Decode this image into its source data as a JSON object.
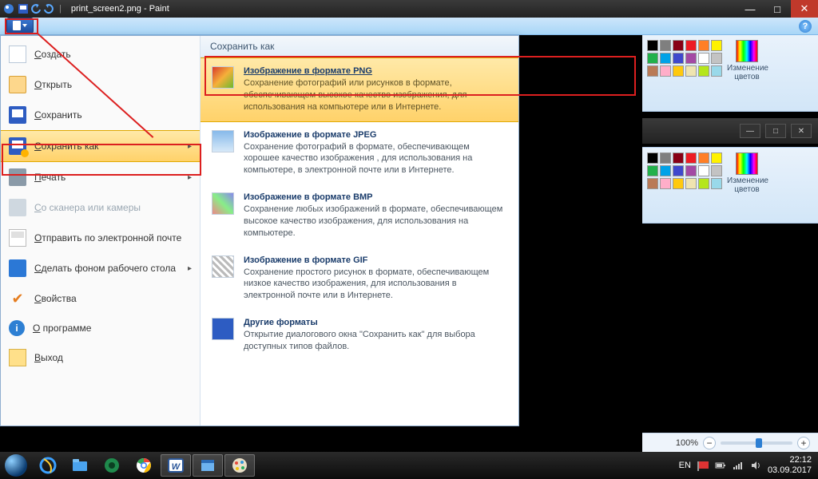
{
  "titlebar": {
    "filename": "print_screen2.png",
    "app": "Paint"
  },
  "winbtns": {
    "min": "—",
    "max": "□",
    "close": "✕"
  },
  "help": "?",
  "filemenu": {
    "items": [
      {
        "label": "Создать",
        "iconcls": "page"
      },
      {
        "label": "Открыть",
        "iconcls": "folder"
      },
      {
        "label": "Сохранить",
        "iconcls": "floppy"
      },
      {
        "label": "Сохранить как",
        "iconcls": "floppy orange",
        "submenu": true,
        "active": true
      },
      {
        "label": "Печать",
        "iconcls": "printer",
        "submenu": true
      },
      {
        "label": "Со сканера или камеры",
        "iconcls": "scanner",
        "disabled": true
      },
      {
        "label": "Отправить по электронной почте",
        "iconcls": "mail"
      },
      {
        "label": "Сделать фоном рабочего стола",
        "iconcls": "desktop",
        "submenu": true
      },
      {
        "label": "Свойства",
        "iconcls": "check"
      },
      {
        "label": "О программе",
        "iconcls": "info"
      },
      {
        "label": "Выход",
        "iconcls": "exitdoor"
      }
    ],
    "saveas": {
      "header": "Сохранить как",
      "formats": [
        {
          "icon": "png",
          "highlight": true,
          "title": "Изображение в формате PNG",
          "desc": "Сохранение фотографий или рисунков в формате, обеспечивающем высокое качество изображения, для использования на компьютере или в Интернете."
        },
        {
          "icon": "jpeg",
          "title": "Изображение в формате JPEG",
          "desc": "Сохранение фотографий в формате, обеспечивающем хорошее качество изображения , для использования на компьютере, в электронной почте или в Интернете."
        },
        {
          "icon": "bmp",
          "title": "Изображение в формате BMP",
          "desc": "Сохранение любых изображений в формате, обеспечивающем высокое качество изображения, для использования на компьютере."
        },
        {
          "icon": "gif",
          "title": "Изображение в формате GIF",
          "desc": "Сохранение простого рисунок в формате, обеспечивающем низкое качество изображения, для использования в электронной почте или в Интернете."
        },
        {
          "icon": "other",
          "title": "Другие форматы",
          "desc": "Открытие диалогового окна \"Сохранить как\" для выбора доступных типов файлов."
        }
      ]
    }
  },
  "colors": {
    "label": "Изменение цветов",
    "row1": [
      "#000",
      "#7f7f7f",
      "#880015",
      "#ed1c24",
      "#ff7f27",
      "#fff200"
    ],
    "row2": [
      "#22b14c",
      "#00a2e8",
      "#3f48cc",
      "#a349a4",
      "#ffffff",
      "#c3c3c3"
    ],
    "row3": [
      "#b97a57",
      "#ffaec9",
      "#ffc90e",
      "#efe4b0",
      "#b5e61d",
      "#99d9ea"
    ]
  },
  "zoom": {
    "pct": "100%",
    "minus": "−",
    "plus": "+"
  },
  "tray": {
    "lang": "EN",
    "time": "22:12",
    "date": "03.09.2017"
  }
}
